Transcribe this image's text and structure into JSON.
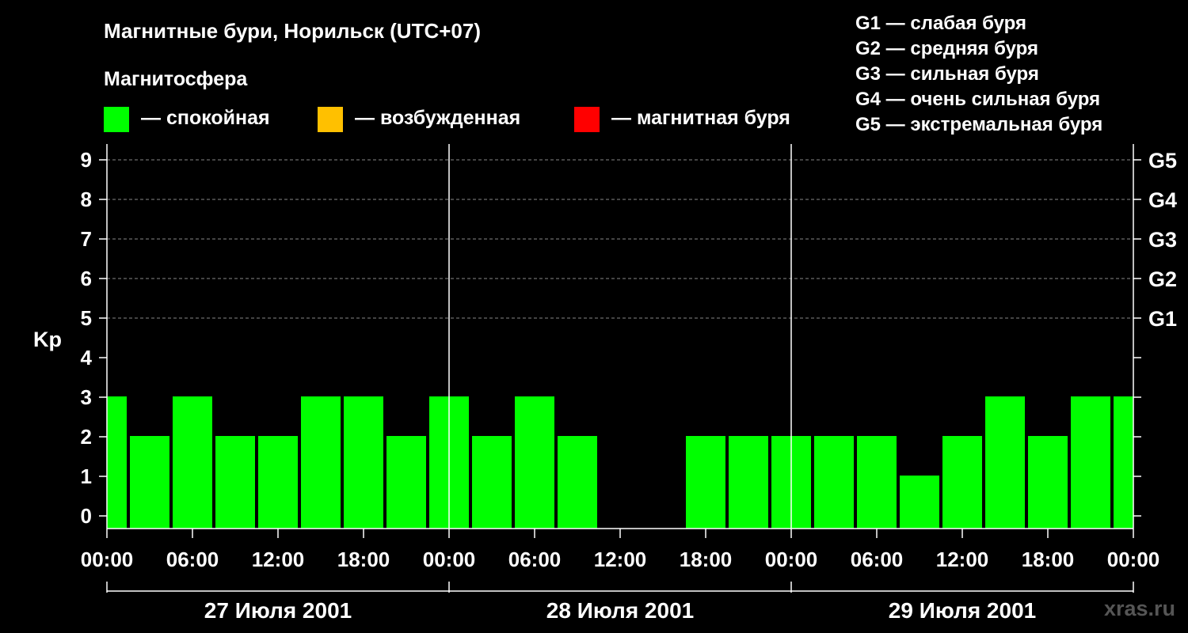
{
  "header": {
    "title": "Магнитные бури, Норильск (UTC+07)",
    "legend_heading": "Магнитосфера"
  },
  "legend": [
    {
      "color": "#00ff00",
      "label": "— спокойная"
    },
    {
      "color": "#ffc000",
      "label": "— возбужденная"
    },
    {
      "color": "#ff0000",
      "label": "— магнитная буря"
    }
  ],
  "g_scale": [
    "G1 — слабая буря",
    "G2 — средняя буря",
    "G3 — сильная буря",
    "G4 — очень сильная буря",
    "G5 — экстремальная буря"
  ],
  "watermark": "xras.ru",
  "chart_data": {
    "type": "bar",
    "ylabel": "Kp",
    "ylim": [
      0,
      9
    ],
    "yticks": [
      0,
      1,
      2,
      3,
      4,
      5,
      6,
      7,
      8,
      9
    ],
    "right_labels": [
      {
        "kp": 5,
        "label": "G1"
      },
      {
        "kp": 6,
        "label": "G2"
      },
      {
        "kp": 7,
        "label": "G3"
      },
      {
        "kp": 8,
        "label": "G4"
      },
      {
        "kp": 9,
        "label": "G5"
      }
    ],
    "grid": "dashed horizontal at Kp 5–9",
    "xtick_labels": [
      "00:00",
      "06:00",
      "12:00",
      "18:00",
      "00:00",
      "06:00",
      "12:00",
      "18:00",
      "00:00",
      "06:00",
      "12:00",
      "18:00",
      "00:00"
    ],
    "days": [
      "27 Июля 2001",
      "28 Июля 2001",
      "29 Июля 2001"
    ],
    "interval_hours": 3,
    "values": [
      3,
      2,
      3,
      2,
      2,
      3,
      3,
      2,
      3,
      2,
      3,
      2,
      null,
      null,
      2,
      2,
      2,
      2,
      2,
      1,
      2,
      3,
      2,
      3,
      3
    ],
    "bar_color": "#00ff00"
  }
}
